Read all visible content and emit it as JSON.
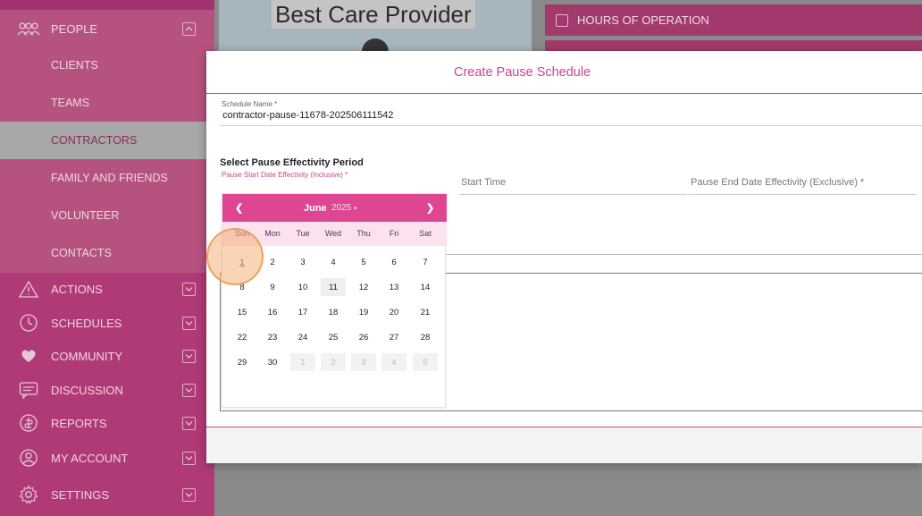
{
  "background": {
    "provider_title": "Best Care Provider",
    "hours_label": "HOURS OF OPERATION"
  },
  "sidebar": {
    "people": "PEOPLE",
    "sub_items": [
      "CLIENTS",
      "TEAMS",
      "CONTRACTORS",
      "FAMILY AND FRIENDS",
      "VOLUNTEER",
      "CONTACTS"
    ],
    "active_sub": "CONTRACTORS",
    "sections": [
      "ACTIONS",
      "SCHEDULES",
      "COMMUNITY",
      "DISCUSSION",
      "REPORTS",
      "MY ACCOUNT",
      "SETTINGS"
    ]
  },
  "modal": {
    "title": "Create Pause Schedule",
    "schedule_name_label": "Schedule Name *",
    "schedule_name_value": "contractor-pause-11678-202506111542",
    "period_title": "Select Pause Effectivity Period",
    "start_date_label": "Pause Start Date Effectivity (Inclusive) *",
    "start_time_label": "Start Time",
    "end_date_label": "Pause End Date Effectivity (Exclusive) *"
  },
  "calendar": {
    "prev": "❮",
    "next": "❯",
    "month": "June",
    "year": "2025",
    "year_caret": "▾",
    "dow": [
      "Sun",
      "Mon",
      "Tue",
      "Wed",
      "Thu",
      "Fri",
      "Sat"
    ],
    "weeks": [
      [
        "1",
        "2",
        "3",
        "4",
        "5",
        "6",
        "7"
      ],
      [
        "8",
        "9",
        "10",
        "11",
        "12",
        "13",
        "14"
      ],
      [
        "15",
        "16",
        "17",
        "18",
        "19",
        "20",
        "21"
      ],
      [
        "22",
        "23",
        "24",
        "25",
        "26",
        "27",
        "28"
      ],
      [
        "29",
        "30",
        "1",
        "2",
        "3",
        "4",
        "5"
      ]
    ],
    "selected_day": "1",
    "today": "11"
  },
  "colors": {
    "accent": "#de4691",
    "sidebar": "#b03a76"
  }
}
